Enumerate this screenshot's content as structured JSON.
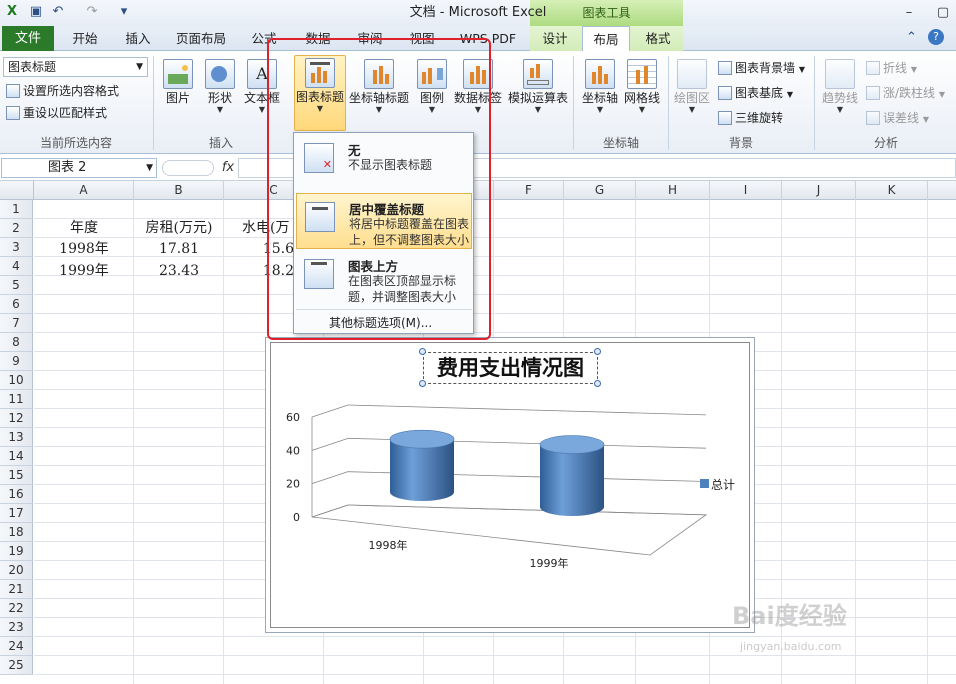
{
  "window": {
    "title": "文档 - Microsoft Excel",
    "context_header": "图表工具"
  },
  "tabs": {
    "file": "文件",
    "items": [
      "开始",
      "插入",
      "页面布局",
      "公式",
      "数据",
      "审阅",
      "视图",
      "WPS PDF",
      "设计",
      "布局",
      "格式"
    ],
    "active": "布局"
  },
  "ribbon": {
    "element_selector": "图表标题",
    "format_selection": "设置所选内容格式",
    "reset_style": "重设以匹配样式",
    "group_current": "当前所选内容",
    "insert": {
      "picture": "图片",
      "shapes": "形状",
      "textbox": "文本框",
      "group": "插入"
    },
    "labels": {
      "chart_title": "图表标题",
      "axis_title": "坐标轴标题",
      "legend": "图例",
      "data_labels": "数据标签",
      "data_table": "模拟运算表"
    },
    "axes": {
      "axes": "坐标轴",
      "gridlines": "网格线",
      "group": "坐标轴"
    },
    "background": {
      "plot_area": "绘图区",
      "wall": "图表背景墙",
      "floor": "图表基底",
      "rotation": "三维旋转",
      "group": "背景"
    },
    "analysis": {
      "trendline": "趋势线",
      "lines": "折线",
      "updown": "涨/跌柱线",
      "errorbars": "误差线",
      "group": "分析"
    }
  },
  "formula_bar": {
    "name_box": "图表 2",
    "fx": "fx"
  },
  "columns": [
    "A",
    "B",
    "C",
    "D",
    "E",
    "F",
    "G",
    "H",
    "I",
    "J",
    "K"
  ],
  "rows": [
    "1",
    "2",
    "3",
    "4",
    "5",
    "6",
    "7",
    "8",
    "9",
    "10",
    "11",
    "12",
    "13",
    "14",
    "15",
    "16",
    "17",
    "18",
    "19",
    "20",
    "21",
    "22",
    "23",
    "24",
    "25"
  ],
  "cells": {
    "a2": "年度",
    "b2": "房租(万元)",
    "c2": "水电(万",
    "a3": "1998年",
    "b3": "17.81",
    "c3": "15.6",
    "a4": "1999年",
    "b4": "23.43",
    "c4": "18.2"
  },
  "menu": {
    "items": [
      {
        "title": "无",
        "desc": "不显示图表标题"
      },
      {
        "title": "居中覆盖标题",
        "desc": "将居中标题覆盖在图表上，但不调整图表大小"
      },
      {
        "title": "图表上方",
        "desc": "在图表区顶部显示标题，并调整图表大小"
      }
    ],
    "more": "其他标题选项(M)..."
  },
  "chart_data": {
    "type": "bar",
    "title": "费用支出情况图",
    "categories": [
      "1998年",
      "1999年"
    ],
    "series": [
      {
        "name": "总计",
        "values": [
          35.2,
          41.6
        ]
      }
    ],
    "ylim": [
      0,
      60
    ],
    "yticks": [
      "0",
      "20",
      "40",
      "60"
    ],
    "grid": true,
    "legend": "right",
    "color": "#4f81bd"
  },
  "watermark": {
    "text": "Bai度经验",
    "sub": "jingyan.baidu.com"
  }
}
